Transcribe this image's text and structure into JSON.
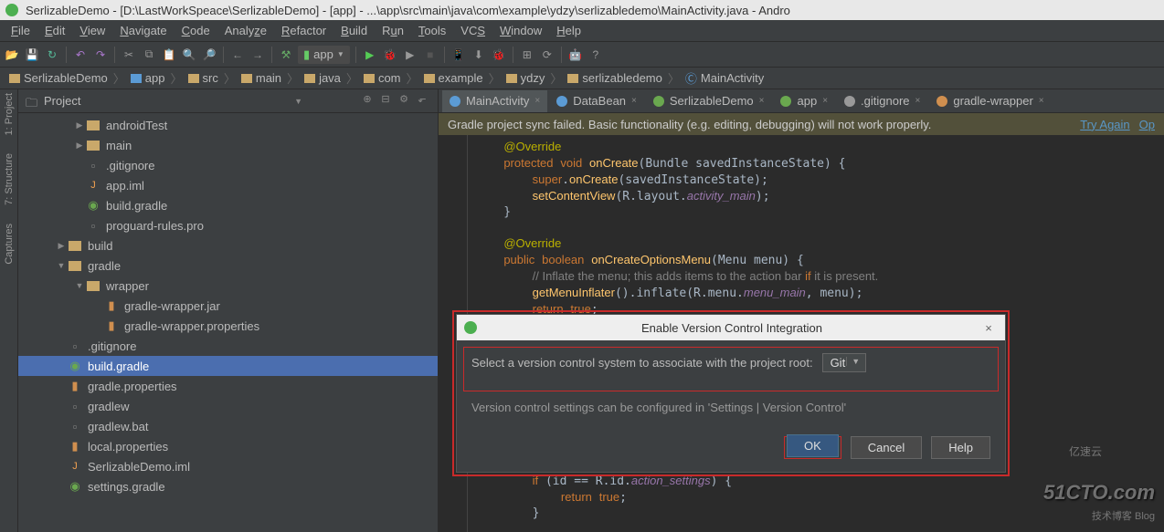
{
  "window": {
    "title": "SerlizableDemo - [D:\\LastWorkSpeace\\SerlizableDemo] - [app] - ...\\app\\src\\main\\java\\com\\example\\ydzy\\serlizabledemo\\MainActivity.java - Andro"
  },
  "menu": [
    "File",
    "Edit",
    "View",
    "Navigate",
    "Code",
    "Analyze",
    "Refactor",
    "Build",
    "Run",
    "Tools",
    "VCS",
    "Window",
    "Help"
  ],
  "run_config": "app",
  "breadcrumbs": [
    {
      "icon": "project",
      "label": "SerlizableDemo"
    },
    {
      "icon": "module",
      "label": "app"
    },
    {
      "icon": "folder",
      "label": "src"
    },
    {
      "icon": "folder",
      "label": "main"
    },
    {
      "icon": "folder",
      "label": "java"
    },
    {
      "icon": "folder",
      "label": "com"
    },
    {
      "icon": "folder",
      "label": "example"
    },
    {
      "icon": "folder",
      "label": "ydzy"
    },
    {
      "icon": "folder",
      "label": "serlizabledemo"
    },
    {
      "icon": "class",
      "label": "MainActivity"
    }
  ],
  "side_tabs": [
    "1: Project",
    "7: Structure",
    "Captures"
  ],
  "project_panel": {
    "title": "Project",
    "tree": [
      {
        "indent": 2,
        "arrow": "▶",
        "icon": "folder",
        "label": "androidTest"
      },
      {
        "indent": 2,
        "arrow": "▶",
        "icon": "folder",
        "label": "main"
      },
      {
        "indent": 2,
        "arrow": "",
        "icon": "file",
        "label": ".gitignore"
      },
      {
        "indent": 2,
        "arrow": "",
        "icon": "file-j",
        "label": "app.iml"
      },
      {
        "indent": 2,
        "arrow": "",
        "icon": "gradle",
        "label": "build.gradle"
      },
      {
        "indent": 2,
        "arrow": "",
        "icon": "file",
        "label": "proguard-rules.pro"
      },
      {
        "indent": 1,
        "arrow": "▶",
        "icon": "folder",
        "label": "build"
      },
      {
        "indent": 1,
        "arrow": "▼",
        "icon": "folder",
        "label": "gradle"
      },
      {
        "indent": 2,
        "arrow": "▼",
        "icon": "folder",
        "label": "wrapper"
      },
      {
        "indent": 3,
        "arrow": "",
        "icon": "jar",
        "label": "gradle-wrapper.jar"
      },
      {
        "indent": 3,
        "arrow": "",
        "icon": "prop",
        "label": "gradle-wrapper.properties"
      },
      {
        "indent": 1,
        "arrow": "",
        "icon": "file",
        "label": ".gitignore"
      },
      {
        "indent": 1,
        "arrow": "",
        "icon": "gradle",
        "label": "build.gradle",
        "selected": true
      },
      {
        "indent": 1,
        "arrow": "",
        "icon": "prop",
        "label": "gradle.properties"
      },
      {
        "indent": 1,
        "arrow": "",
        "icon": "file",
        "label": "gradlew"
      },
      {
        "indent": 1,
        "arrow": "",
        "icon": "file",
        "label": "gradlew.bat"
      },
      {
        "indent": 1,
        "arrow": "",
        "icon": "prop",
        "label": "local.properties"
      },
      {
        "indent": 1,
        "arrow": "",
        "icon": "file-j",
        "label": "SerlizableDemo.iml"
      },
      {
        "indent": 1,
        "arrow": "",
        "icon": "gradle",
        "label": "settings.gradle"
      }
    ]
  },
  "editor_tabs": [
    {
      "label": "MainActivity",
      "color": "#5b9bd5",
      "active": true
    },
    {
      "label": "DataBean",
      "color": "#5b9bd5"
    },
    {
      "label": "SerlizableDemo",
      "color": "#6aa84f"
    },
    {
      "label": "app",
      "color": "#6aa84f"
    },
    {
      "label": ".gitignore",
      "color": "#999"
    },
    {
      "label": "gradle-wrapper",
      "color": "#d08f4f"
    }
  ],
  "warn_bar": {
    "text": "Gradle project sync failed. Basic functionality (e.g. editing, debugging) will not work properly.",
    "link1": "Try Again",
    "link2": "Op"
  },
  "code_lines": [
    "    @Override",
    "    protected void onCreate(Bundle savedInstanceState) {",
    "        super.onCreate(savedInstanceState);",
    "        setContentView(R.layout.activity_main);",
    "    }",
    "",
    "    @Override",
    "    public boolean onCreateOptionsMenu(Menu menu) {",
    "        // Inflate the menu; this adds items to the action bar if it is present.",
    "        getMenuInflater().inflate(R.menu.menu_main, menu);",
    "        return true;",
    "    }",
    "",
    "",
    "",
    "",
    "",
    "",
    "",
    "",
    "",
    "        if (id == R.id.action_settings) {",
    "            return true;",
    "        }"
  ],
  "dialog": {
    "title": "Enable Version Control Integration",
    "prompt": "Select a version control system to associate with the project root:",
    "selected_vcs": "Git",
    "hint": "Version control settings can be configured in 'Settings | Version Control'",
    "ok": "OK",
    "cancel": "Cancel",
    "help": "Help"
  },
  "watermark": "51CTO.com",
  "watermark_sub": "技术博客  Blog",
  "watermark_left": "亿速云"
}
